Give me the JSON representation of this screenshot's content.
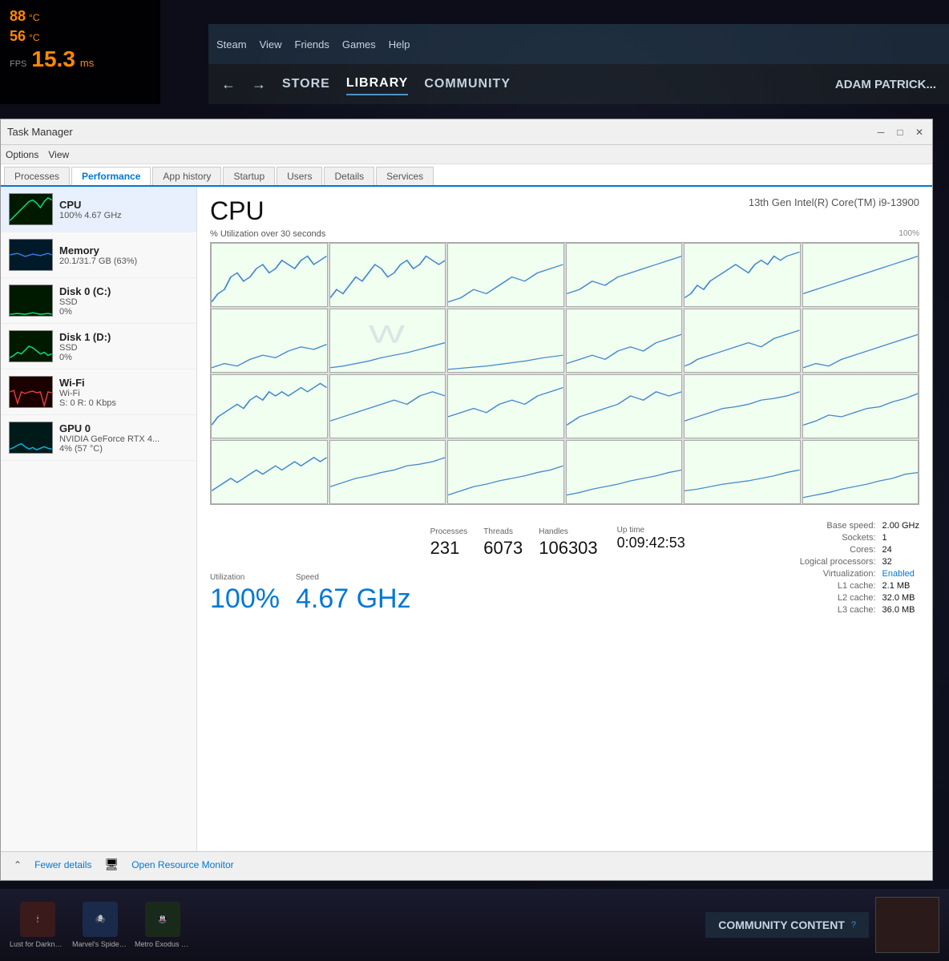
{
  "hud": {
    "temp1_value": "88",
    "temp1_unit": "°C",
    "temp2_value": "56",
    "temp2_unit": "°C",
    "fps_label": "FPS",
    "fps_value": "15.3",
    "fps_ms": "ms"
  },
  "steam": {
    "menu": [
      "Steam",
      "View",
      "Friends",
      "Games",
      "Help"
    ],
    "nav": [
      "←",
      "→",
      "STORE",
      "LIBRARY",
      "COMMUNITY",
      "ADAM PATRICK..."
    ],
    "active_nav": "LIBRARY"
  },
  "task_manager": {
    "title": "Task Manager",
    "menus": [
      "Options",
      "View"
    ],
    "tabs": [
      "Processes",
      "Performance",
      "App history",
      "Startup",
      "Users",
      "Details",
      "Services"
    ],
    "active_tab": "Performance",
    "sidebar": [
      {
        "name": "CPU",
        "sub1": "100% 4.67 GHz",
        "type": "cpu"
      },
      {
        "name": "Memory",
        "sub1": "20.1/31.7 GB (63%)",
        "type": "mem"
      },
      {
        "name": "Disk 0 (C:)",
        "sub1": "SSD",
        "sub2": "0%",
        "type": "disk"
      },
      {
        "name": "Disk 1 (D:)",
        "sub1": "SSD",
        "sub2": "0%",
        "type": "disk1"
      },
      {
        "name": "Wi-Fi",
        "sub1": "Wi-Fi",
        "sub2": "S: 0 R: 0 Kbps",
        "type": "wifi"
      },
      {
        "name": "GPU 0",
        "sub1": "NVIDIA GeForce RTX 4...",
        "sub2": "4% (57 °C)",
        "type": "gpu"
      }
    ],
    "cpu": {
      "title": "CPU",
      "model": "13th Gen Intel(R) Core(TM) i9-13900",
      "util_label": "% Utilization over 30 seconds",
      "util_pct": "100%",
      "max_label": "100%",
      "utilization_label": "Utilization",
      "utilization_value": "100%",
      "speed_label": "Speed",
      "speed_value": "4.67 GHz",
      "processes_label": "Processes",
      "processes_value": "231",
      "threads_label": "Threads",
      "threads_value": "6073",
      "handles_label": "Handles",
      "handles_value": "106303",
      "uptime_label": "Up time",
      "uptime_value": "0:09:42:53",
      "base_speed_label": "Base speed:",
      "base_speed_value": "2.00 GHz",
      "sockets_label": "Sockets:",
      "sockets_value": "1",
      "cores_label": "Cores:",
      "cores_value": "24",
      "logical_label": "Logical processors:",
      "logical_value": "32",
      "virt_label": "Virtualization:",
      "virt_value": "Enabled",
      "l1_label": "L1 cache:",
      "l1_value": "2.1 MB",
      "l2_label": "L2 cache:",
      "l2_value": "32.0 MB",
      "l3_label": "L3 cache:",
      "l3_value": "36.0 MB"
    },
    "footer": {
      "fewer_label": "Fewer details",
      "monitor_label": "Open Resource Monitor"
    }
  },
  "taskbar": {
    "items": [
      {
        "label": "Lust for Darkness",
        "color": "#2a1a1a"
      },
      {
        "label": "Marvel's Spider-Man: Miles Mora...",
        "color": "#1a2a3a"
      },
      {
        "label": "Metro Exodus Enhanced ...",
        "color": "#1a2a1a"
      }
    ],
    "community_title": "COMMUNITY CONTENT"
  }
}
